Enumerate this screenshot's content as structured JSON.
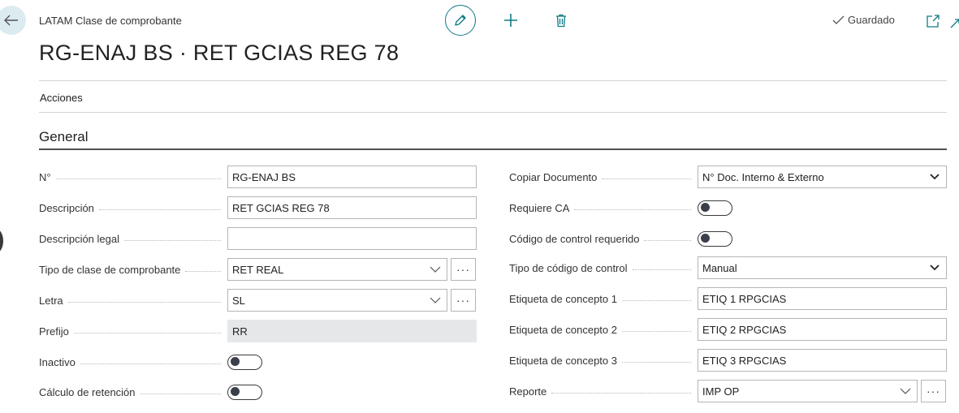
{
  "header": {
    "subtitle": "LATAM Clase de comprobante",
    "title": "RG-ENAJ BS · RET GCIAS REG 78",
    "saved_label": "Guardado",
    "icons": [
      "back-arrow-icon",
      "pencil-icon",
      "plus-icon",
      "trash-icon",
      "check-icon",
      "popout-icon",
      "expand-icon"
    ]
  },
  "menu": {
    "actions_label": "Acciones"
  },
  "section": {
    "title": "General"
  },
  "left_fields": {
    "numero": {
      "label": "N°",
      "value": "RG-ENAJ BS"
    },
    "descripcion": {
      "label": "Descripción",
      "value": "RET GCIAS REG 78"
    },
    "descripcion_legal": {
      "label": "Descripción legal",
      "value": ""
    },
    "tipo_clase": {
      "label": "Tipo de clase de comprobante",
      "value": "RET REAL"
    },
    "letra": {
      "label": "Letra",
      "value": "SL"
    },
    "prefijo": {
      "label": "Prefijo",
      "value": "RR"
    },
    "inactivo": {
      "label": "Inactivo",
      "value": false
    },
    "calculo_retencion": {
      "label": "Cálculo de retención",
      "value": false
    }
  },
  "right_fields": {
    "copiar_documento": {
      "label": "Copiar Documento",
      "value": "N° Doc. Interno & Externo"
    },
    "requiere_ca": {
      "label": "Requiere CA",
      "value": false
    },
    "codigo_control_requerido": {
      "label": "Código de control requerido",
      "value": false
    },
    "tipo_codigo_control": {
      "label": "Tipo de código de control",
      "value": "Manual"
    },
    "etiqueta_1": {
      "label": "Etiqueta de concepto 1",
      "value": "ETIQ 1 RPGCIAS"
    },
    "etiqueta_2": {
      "label": "Etiqueta de concepto 2",
      "value": "ETIQ 2 RPGCIAS"
    },
    "etiqueta_3": {
      "label": "Etiqueta de concepto 3",
      "value": "ETIQ 3 RPGCIAS"
    },
    "reporte": {
      "label": "Reporte",
      "value": "IMP OP"
    }
  },
  "more_button_label": "···",
  "colors": {
    "accent": "#0f7b85",
    "back_bg": "#dcebf0",
    "readonly_bg": "#e6e7e9"
  }
}
